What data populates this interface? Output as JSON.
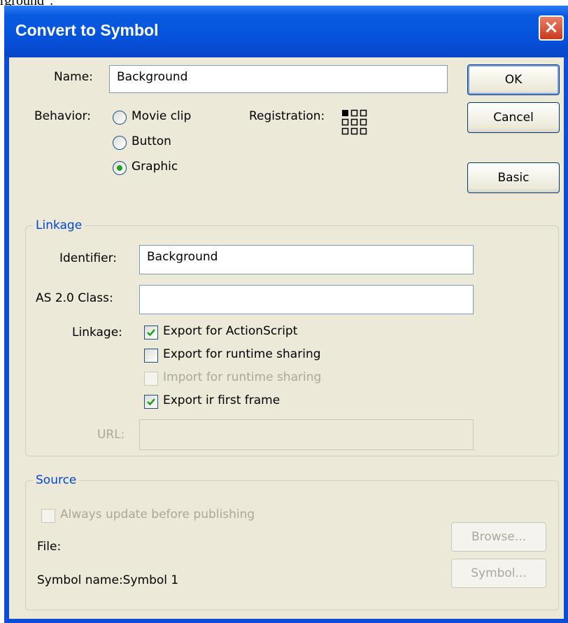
{
  "background_text": "rground\".",
  "window": {
    "title": "Convert to Symbol",
    "close_glyph": "×"
  },
  "name": {
    "label": "Name:",
    "value": "Background"
  },
  "behavior": {
    "label": "Behavior:",
    "options": [
      "Movie clip",
      "Button",
      "Graphic"
    ],
    "selected": "Graphic"
  },
  "registration": {
    "label": "Registration:",
    "icon": "registration-grid-icon"
  },
  "buttons": {
    "ok": "OK",
    "cancel": "Cancel",
    "basic": "Basic"
  },
  "linkage": {
    "group_label": "Linkage",
    "identifier_label": "Identifier:",
    "identifier_value": "Background",
    "class_label": "AS 2.0 Class:",
    "class_value": "",
    "linkage_label": "Linkage:",
    "options": [
      {
        "label": "Export for ActionScript",
        "checked": true,
        "enabled": true
      },
      {
        "label": "Export for runtime sharing",
        "checked": false,
        "enabled": true
      },
      {
        "label": "Import for runtime sharing",
        "checked": false,
        "enabled": false
      },
      {
        "label": "Export ir first frame",
        "checked": true,
        "enabled": true
      }
    ],
    "url_label": "URL:",
    "url_value": ""
  },
  "source": {
    "group_label": "Source",
    "always_update_label": "Always update before publishing",
    "file_label": "File:",
    "symbol_name_label": "Symbol name:Symbol 1",
    "browse_button": "Browse...",
    "symbol_button": "Symbol..."
  },
  "colors": {
    "titlebar": "#0553dc",
    "dialog_bg": "#ece9d8",
    "group_label": "#0046d5",
    "check": "#21a121"
  }
}
